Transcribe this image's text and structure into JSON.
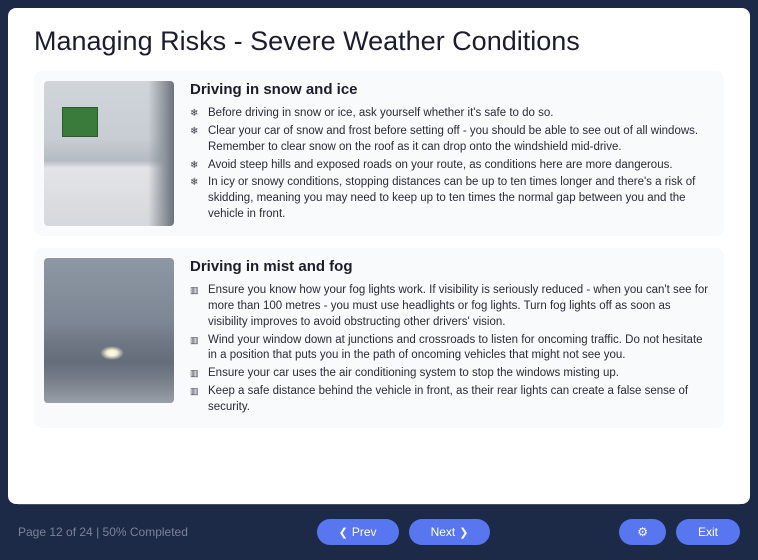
{
  "title": "Managing Risks - Severe Weather Conditions",
  "sections": [
    {
      "heading": "Driving in snow and ice",
      "items": [
        "Before driving in snow or ice, ask yourself whether it's safe to do so.",
        "Clear your car of snow and frost before setting off - you should be able to see out of all windows. Remember to clear snow on the roof as it can drop onto the windshield mid-drive.",
        "Avoid steep hills and exposed roads on your route, as conditions here are more dangerous.",
        "In icy or snowy conditions, stopping distances can be up to ten times longer and there's a risk of skidding, meaning you may need to keep up to ten times the normal gap between you and the vehicle in front."
      ]
    },
    {
      "heading": "Driving in mist and fog",
      "items": [
        "Ensure you know how your fog lights work. If visibility is seriously reduced - when you can't see for more than 100 metres - you must use headlights or fog lights. Turn fog lights off as soon as visibility improves to avoid obstructing other drivers' vision.",
        "Wind your window down at junctions and crossroads to listen for oncoming traffic. Do not hesitate in a position that puts you in the path of oncoming vehicles that might not see you.",
        "Ensure your car uses the air conditioning system to stop the windows misting up.",
        "Keep a safe distance behind the vehicle in front, as their rear lights can create a false sense of security."
      ]
    }
  ],
  "footer": {
    "progress": "Page 12 of 24 | 50% Completed",
    "prev": "Prev",
    "next": "Next",
    "exit": "Exit"
  }
}
